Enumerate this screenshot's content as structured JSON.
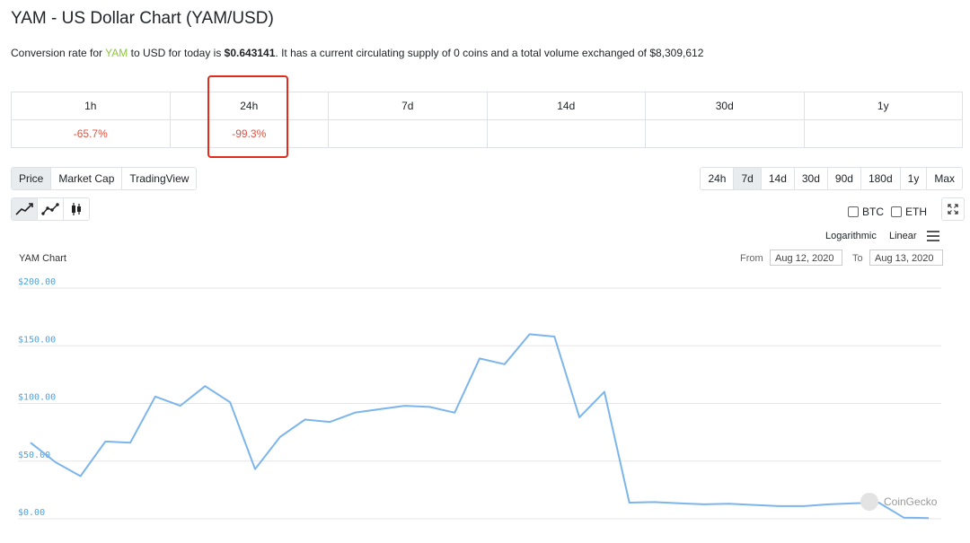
{
  "title": "YAM - US Dollar Chart (YAM/USD)",
  "summary": {
    "prefix": "Conversion rate for ",
    "coin": "YAM",
    "middle": " to USD for today is ",
    "rate": "$0.643141",
    "suffix": ". It has a current circulating supply of 0 coins and a total volume exchanged of $8,309,612"
  },
  "changes": {
    "headers": [
      "1h",
      "24h",
      "7d",
      "14d",
      "30d",
      "1y"
    ],
    "values": [
      "-65.7%",
      "-99.3%",
      "",
      "",
      "",
      ""
    ]
  },
  "chart_tabs": [
    "Price",
    "Market Cap",
    "TradingView"
  ],
  "range_buttons": [
    "24h",
    "7d",
    "14d",
    "30d",
    "90d",
    "180d",
    "1y",
    "Max"
  ],
  "active_range": "7d",
  "tools": [
    "line-chart-icon",
    "line-points-icon",
    "candlestick-icon"
  ],
  "compare": {
    "btc": "BTC",
    "eth": "ETH"
  },
  "scale": {
    "log": "Logarithmic",
    "linear": "Linear"
  },
  "range_picker": {
    "from_label": "From",
    "from": "Aug 12, 2020",
    "to_label": "To",
    "to": "Aug 13, 2020"
  },
  "watermark": "CoinGecko",
  "colors": {
    "line": "#7cb5ec",
    "negative": "#e15241",
    "highlight": "#e02b1d",
    "coin": "#8dc63f"
  },
  "chart_data": {
    "type": "line",
    "title": "YAM Chart",
    "y_ticks": [
      "$200.00",
      "$150.00",
      "$100.00",
      "$50.00",
      "$0.00"
    ],
    "ylim": [
      0,
      200
    ],
    "grid": true,
    "series": [
      {
        "values": [
          66,
          49,
          37,
          67,
          66,
          106,
          98,
          115,
          101,
          43,
          71,
          86,
          84,
          92,
          95,
          98,
          97,
          92,
          139,
          134,
          160,
          158,
          88,
          110,
          14,
          14.5,
          13.5,
          12.5,
          13,
          12,
          11,
          11,
          12.5,
          13.5,
          14,
          1,
          0.6
        ]
      }
    ]
  }
}
